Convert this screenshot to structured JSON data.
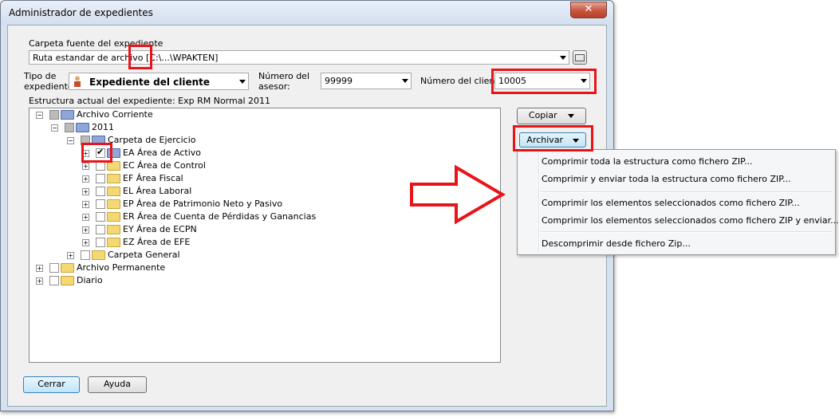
{
  "window": {
    "title": "Administrador de expedientes",
    "close_label": "✕"
  },
  "source": {
    "group_label": "Carpeta fuente del expediente",
    "path_value": "Ruta estandar de archivo  [C:\\...\\WPAKTEN]",
    "browse_label": "..."
  },
  "fields": {
    "tipo_label_1": "Tipo de",
    "tipo_label_2": "expediente:",
    "tipo_value": "Expediente del cliente",
    "asesor_label_1": "Número del",
    "asesor_label_2": "asesor:",
    "asesor_value": "99999",
    "cliente_label": "Número del cliente",
    "cliente_value": "10005"
  },
  "structure_label": "Estructura actual del expediente: Exp RM Normal 2011",
  "tree": {
    "archivo_corriente": "Archivo Corriente",
    "y2011": "2011",
    "carpeta_ejercicio": "Carpeta de Ejercicio",
    "ea": "EA Área de Activo",
    "ec": "EC Área de Control",
    "ef": "EF Área Fiscal",
    "el": "EL Área Laboral",
    "ep": "EP Área de Patrimonio Neto y Pasivo",
    "er": "ER Área de Cuenta de Pérdidas y Ganancias",
    "ey": "EY Área de ECPN",
    "ez": "EZ Área de EFE",
    "carpeta_general": "Carpeta General",
    "archivo_permanente": "Archivo Permanente",
    "diario": "Diario"
  },
  "buttons": {
    "copiar": "Copiar",
    "archivar": "Archivar",
    "cerrar": "Cerrar",
    "ayuda": "Ayuda"
  },
  "menu": {
    "item1": "Comprimir toda la estructura como fichero ZIP...",
    "item2": "Comprimir y enviar toda la estructura como fichero ZIP...",
    "item3": "Comprimir los elementos seleccionados como fichero ZIP...",
    "item4": "Comprimir los elementos seleccionados como fichero ZIP y enviar...",
    "item5": "Descomprimir desde fichero Zip..."
  },
  "colors": {
    "highlight": "#e8141a",
    "window_frame": "#d6e1ef"
  }
}
